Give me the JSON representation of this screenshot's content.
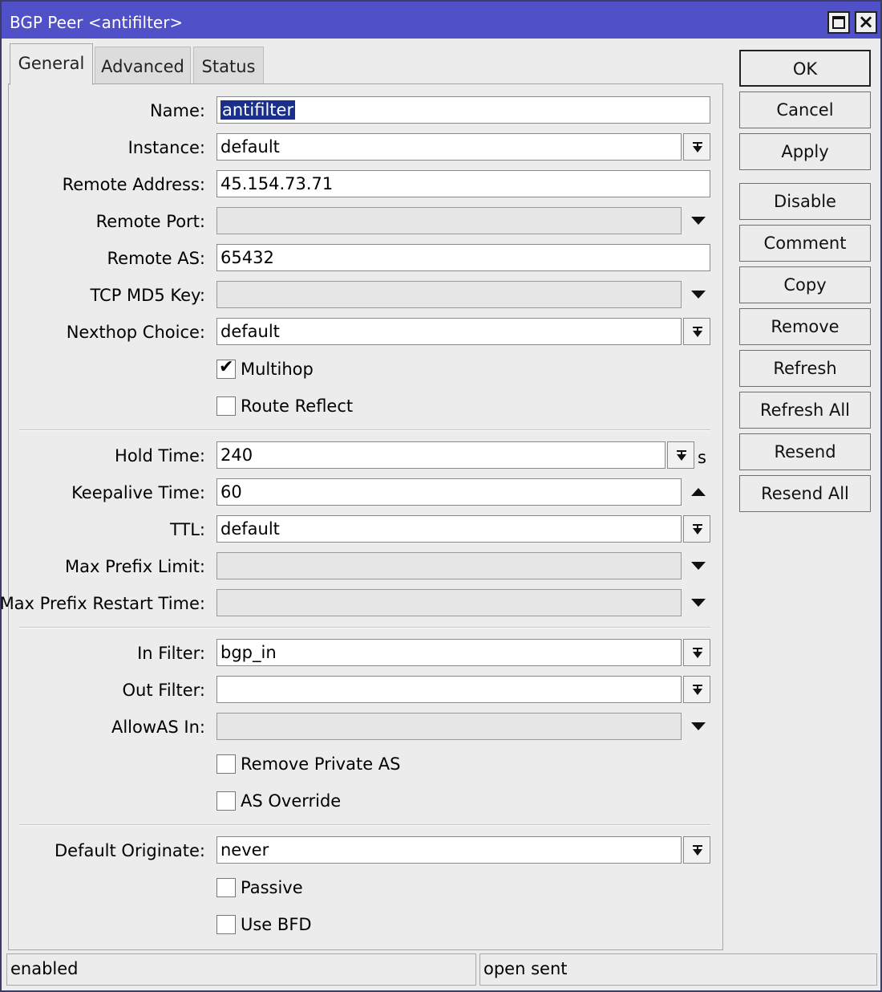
{
  "window": {
    "title": "BGP Peer <antifilter>"
  },
  "tabs": [
    {
      "label": "General",
      "active": true
    },
    {
      "label": "Advanced",
      "active": false
    },
    {
      "label": "Status",
      "active": false
    }
  ],
  "fields": {
    "name": {
      "label": "Name:",
      "value": "antifilter"
    },
    "instance": {
      "label": "Instance:",
      "value": "default"
    },
    "remote_address": {
      "label": "Remote Address:",
      "value": "45.154.73.71"
    },
    "remote_port": {
      "label": "Remote Port:",
      "value": ""
    },
    "remote_as": {
      "label": "Remote AS:",
      "value": "65432"
    },
    "tcp_md5_key": {
      "label": "TCP MD5 Key:",
      "value": ""
    },
    "nexthop_choice": {
      "label": "Nexthop Choice:",
      "value": "default"
    },
    "hold_time": {
      "label": "Hold Time:",
      "value": "240",
      "unit": "s"
    },
    "keepalive_time": {
      "label": "Keepalive Time:",
      "value": "60"
    },
    "ttl": {
      "label": "TTL:",
      "value": "default"
    },
    "max_prefix_limit": {
      "label": "Max Prefix Limit:",
      "value": ""
    },
    "max_prefix_restart_time": {
      "label": "Max Prefix Restart Time:",
      "value": ""
    },
    "in_filter": {
      "label": "In Filter:",
      "value": "bgp_in"
    },
    "out_filter": {
      "label": "Out Filter:",
      "value": ""
    },
    "allowas_in": {
      "label": "AllowAS In:",
      "value": ""
    },
    "default_originate": {
      "label": "Default Originate:",
      "value": "never"
    }
  },
  "checkboxes": {
    "multihop": {
      "label": "Multihop",
      "checked": true,
      "mark": "✔"
    },
    "route_reflect": {
      "label": "Route Reflect",
      "checked": false
    },
    "remove_private_as": {
      "label": "Remove Private AS",
      "checked": false
    },
    "as_override": {
      "label": "AS Override",
      "checked": false
    },
    "passive": {
      "label": "Passive",
      "checked": false
    },
    "use_bfd": {
      "label": "Use BFD",
      "checked": false
    }
  },
  "buttons": {
    "ok": "OK",
    "cancel": "Cancel",
    "apply": "Apply",
    "disable": "Disable",
    "comment": "Comment",
    "copy": "Copy",
    "remove": "Remove",
    "refresh": "Refresh",
    "refresh_all": "Refresh All",
    "resend": "Resend",
    "resend_all": "Resend All"
  },
  "status": {
    "left": "enabled",
    "right": "open sent"
  }
}
